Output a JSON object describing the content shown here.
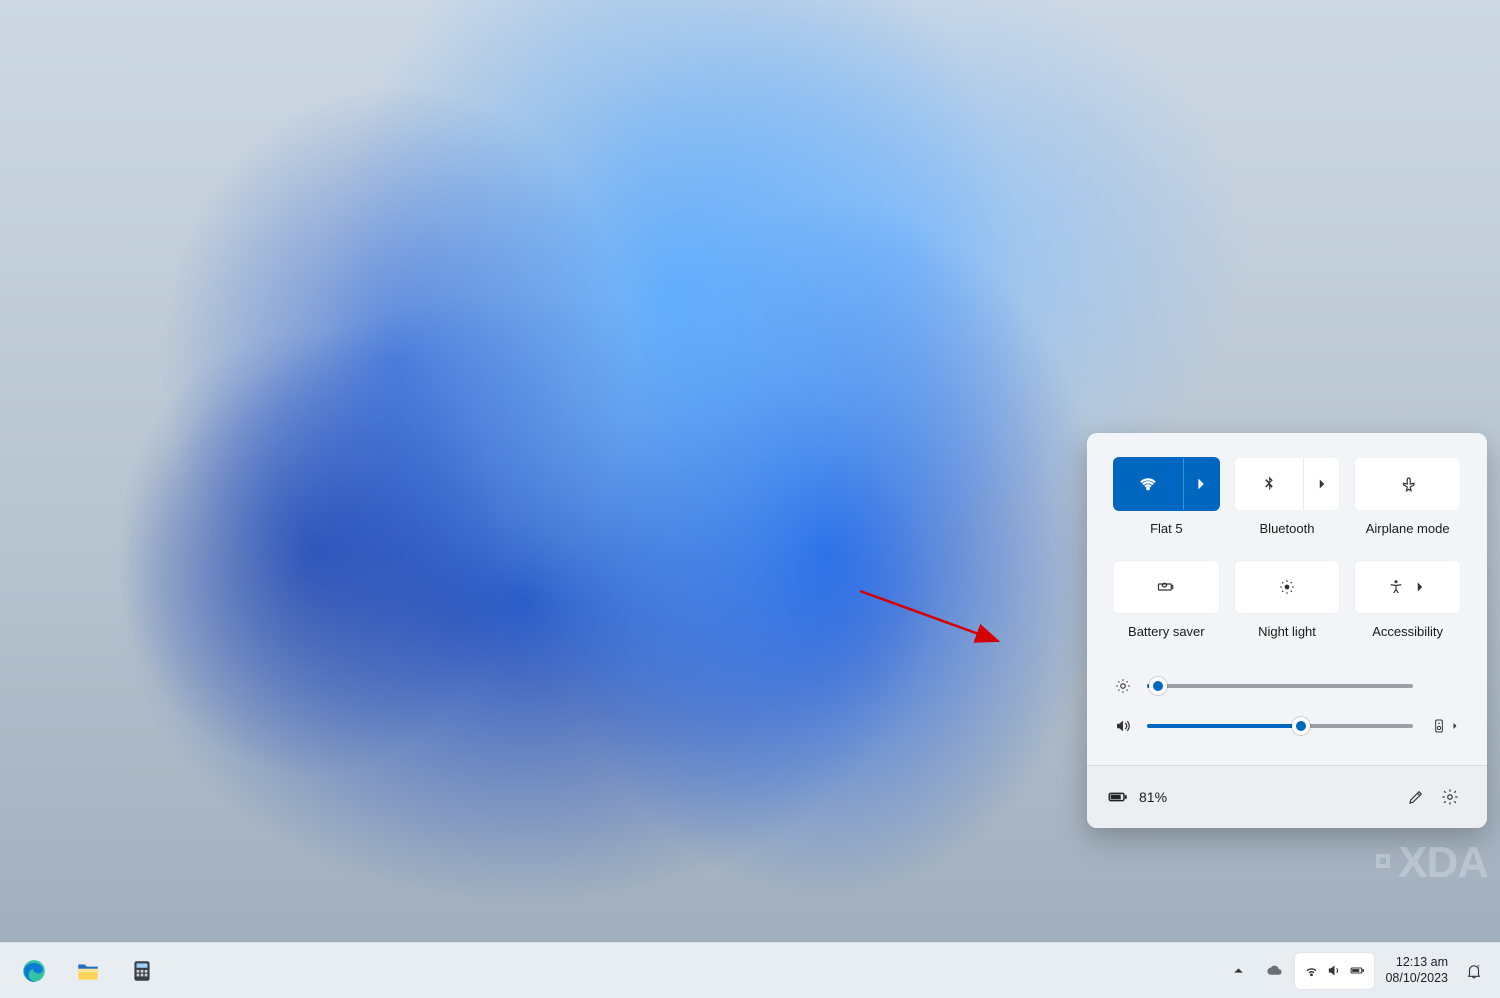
{
  "quick_settings": {
    "tiles": {
      "wifi": {
        "label": "Flat 5",
        "active": true
      },
      "bluetooth": {
        "label": "Bluetooth",
        "active": false
      },
      "airplane": {
        "label": "Airplane mode",
        "active": false
      },
      "battery_saver": {
        "label": "Battery saver",
        "active": false
      },
      "night_light": {
        "label": "Night light",
        "active": false
      },
      "accessibility": {
        "label": "Accessibility",
        "active": false
      }
    },
    "brightness_percent": 4,
    "volume_percent": 58,
    "battery_text": "81%"
  },
  "taskbar": {
    "time": "12:13 am",
    "date": "08/10/2023"
  },
  "watermark": "XDA",
  "colors": {
    "accent": "#0067c0"
  }
}
